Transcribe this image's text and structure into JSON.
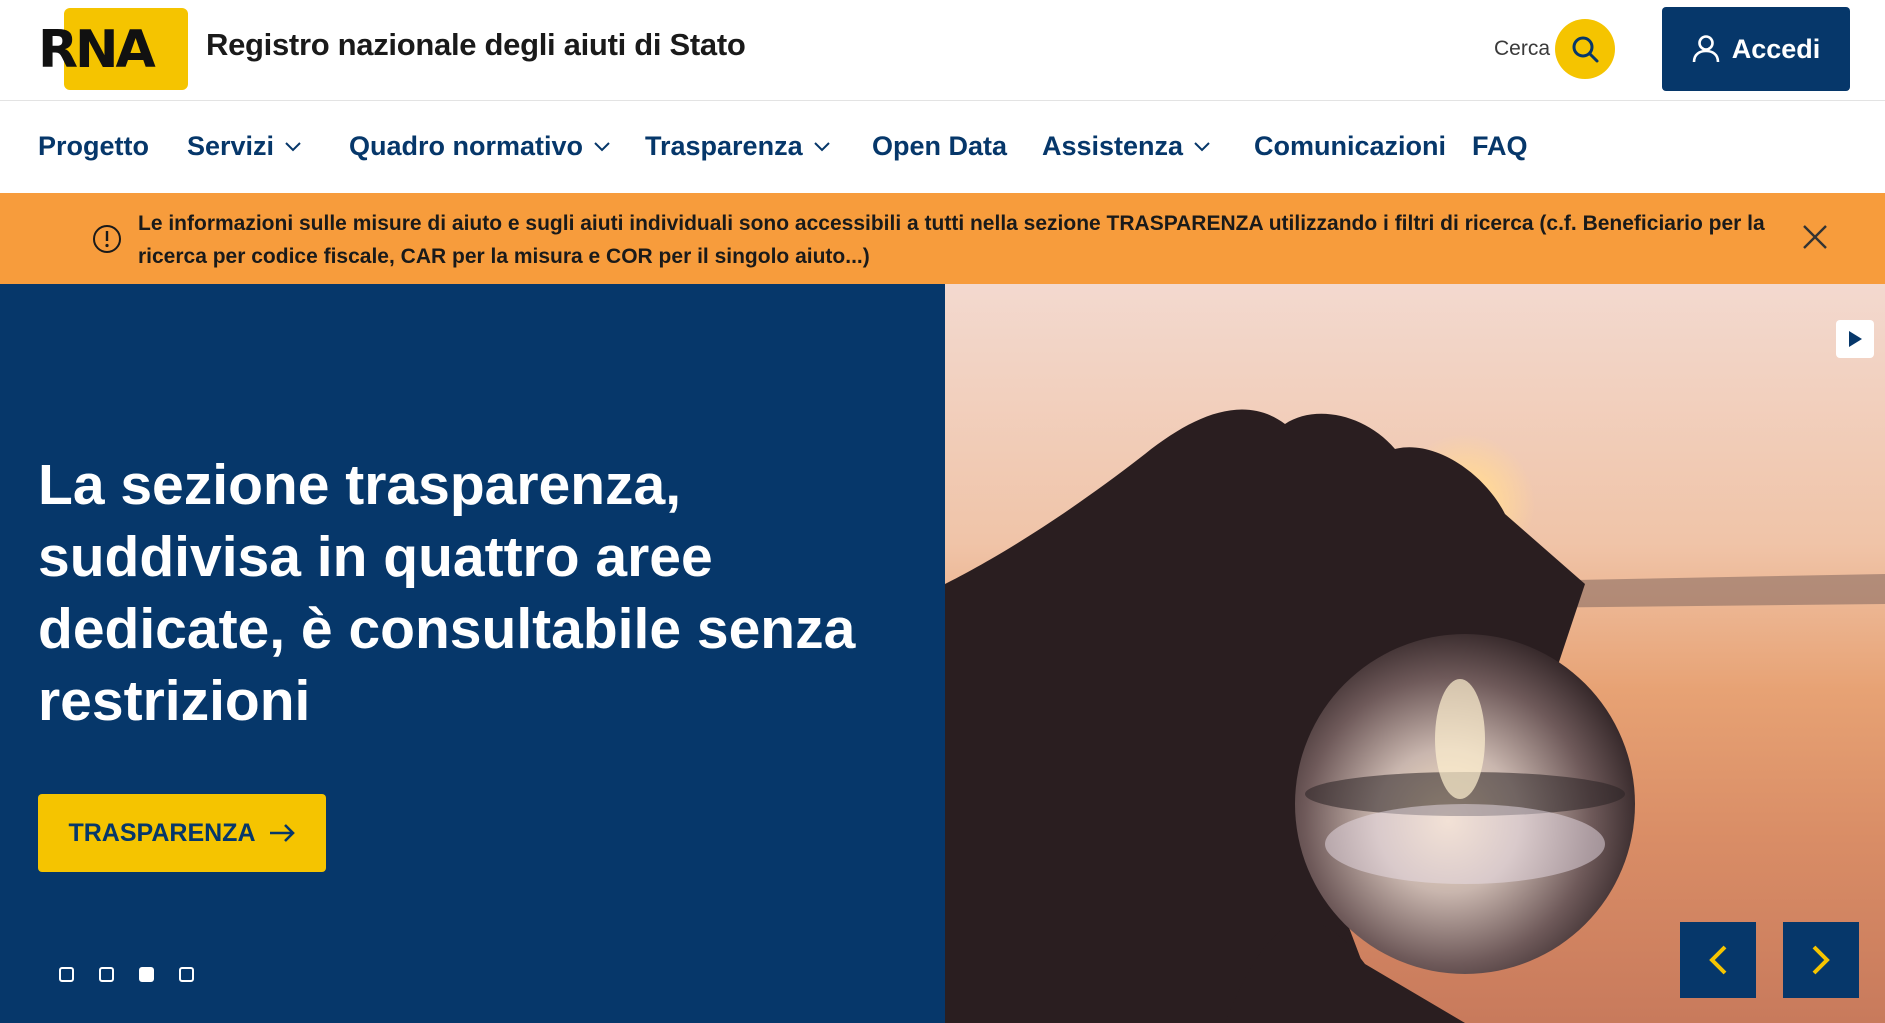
{
  "header": {
    "logo_text": "RNA",
    "site_title": "Registro nazionale degli aiuti di Stato",
    "search_label": "Cerca",
    "login_label": "Accedi"
  },
  "nav": {
    "items": [
      {
        "label": "Progetto",
        "has_dropdown": false
      },
      {
        "label": "Servizi",
        "has_dropdown": true
      },
      {
        "label": "Quadro normativo",
        "has_dropdown": true
      },
      {
        "label": "Trasparenza",
        "has_dropdown": true
      },
      {
        "label": "Open Data",
        "has_dropdown": false
      },
      {
        "label": "Assistenza",
        "has_dropdown": true
      },
      {
        "label": "Comunicazioni",
        "has_dropdown": false
      },
      {
        "label": "FAQ",
        "has_dropdown": false
      }
    ]
  },
  "alert": {
    "line1": "Le informazioni sulle misure di aiuto e sugli aiuti individuali sono accessibili a tutti nella sezione TRASPARENZA utilizzando i filtri di ricerca (c.f. Beneficiario per la",
    "line2": "ricerca per codice fiscale, CAR per la misura e COR per il singolo aiuto...)"
  },
  "hero": {
    "heading_lines": [
      "La sezione trasparenza,",
      "suddivisa in quattro aree",
      "dedicate, è consultabile senza",
      "restrizioni"
    ],
    "cta_label": "TRASPARENZA",
    "slides_total": 4,
    "active_slide": 3
  },
  "colors": {
    "primary": "#06376a",
    "accent": "#f5c400",
    "alert_bg": "#f79c3c"
  }
}
